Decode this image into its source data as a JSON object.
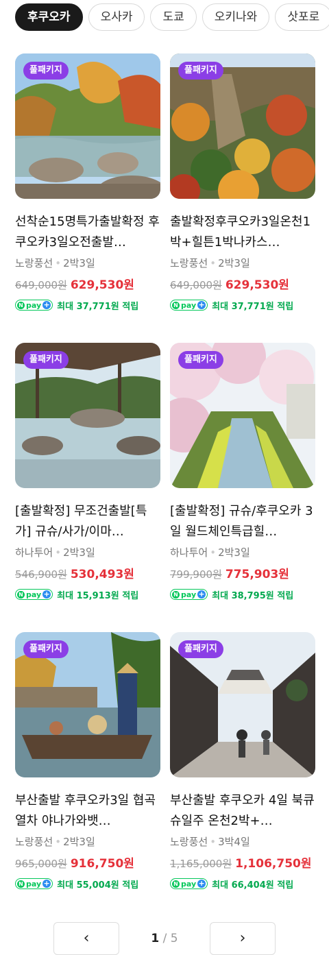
{
  "tabs": [
    {
      "label": "후쿠오카",
      "active": true
    },
    {
      "label": "오사카",
      "active": false
    },
    {
      "label": "도쿄",
      "active": false
    },
    {
      "label": "오키나와",
      "active": false
    },
    {
      "label": "삿포로",
      "active": false
    }
  ],
  "products": [
    {
      "badge": "풀패키지",
      "title": "선착순15명특가출발확정 후쿠오카3일오전출발…",
      "agency": "노랑풍선",
      "duration": "2박3일",
      "original_price": "649,000원",
      "sale_price": "629,530원",
      "point_text": "최대 37,771원 적립",
      "scene": "hot-spring-autumn"
    },
    {
      "badge": "풀패키지",
      "title": "출발확정후쿠오카3일온천1박+힐튼1박나카스…",
      "agency": "노랑풍선",
      "duration": "2박3일",
      "original_price": "649,000원",
      "sale_price": "629,530원",
      "point_text": "최대 37,771원 적립",
      "scene": "autumn-gorge"
    },
    {
      "badge": "풀패키지",
      "title": "[출발확정] 무조건출발[특가] 규슈/사가/이마…",
      "agency": "하나투어",
      "duration": "2박3일",
      "original_price": "546,900원",
      "sale_price": "530,493원",
      "point_text": "최대 15,913원 적립",
      "scene": "onsen-pavilion"
    },
    {
      "badge": "풀패키지",
      "title": "[출발확정] 규슈/후쿠오카 3일 월드체인특급힐…",
      "agency": "하나투어",
      "duration": "2박3일",
      "original_price": "799,900원",
      "sale_price": "775,903원",
      "point_text": "최대 38,795원 적립",
      "scene": "cherry-canal"
    },
    {
      "badge": "풀패키지",
      "title": "부산출발 후쿠오카3일 협곡열차 야나가와뱃…",
      "agency": "노랑풍선",
      "duration": "2박3일",
      "original_price": "965,000원",
      "sale_price": "916,750원",
      "point_text": "최대 55,004원 적립",
      "scene": "yanagawa-boat"
    },
    {
      "badge": "풀패키지",
      "title": "부산출발 후쿠오카 4일 북큐슈일주 온천2박+…",
      "agency": "노랑풍선",
      "duration": "3박4일",
      "original_price": "1,165,000원",
      "sale_price": "1,106,750원",
      "point_text": "최대 66,404원 적립",
      "scene": "old-street"
    }
  ],
  "npay": {
    "logo_text": "pay"
  },
  "pagination": {
    "current": "1",
    "separator": "/",
    "total": "5",
    "prev_icon": "chevron-left-icon",
    "next_icon": "chevron-right-icon"
  },
  "colors": {
    "accent_badge": "#8b3ee6",
    "sale_price": "#e5313a",
    "point": "#03a94f",
    "npay": "#03c75a",
    "active_tab": "#1a1a1a"
  }
}
